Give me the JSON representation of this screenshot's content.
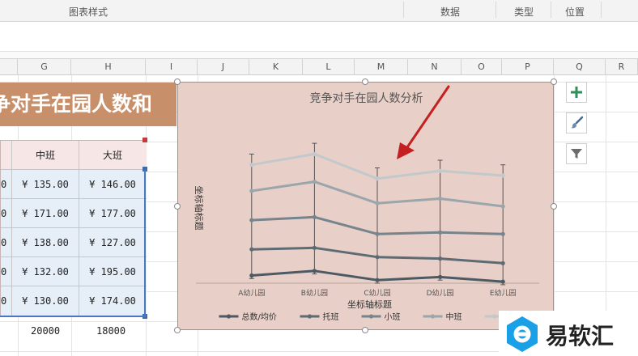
{
  "ribbon": {
    "groups": [
      {
        "label": "图表样式"
      },
      {
        "label": "数据"
      },
      {
        "label": "类型"
      },
      {
        "label": "位置"
      }
    ]
  },
  "columns": [
    "G",
    "H",
    "I",
    "J",
    "K",
    "L",
    "M",
    "N",
    "O",
    "P",
    "Q",
    "R"
  ],
  "sheet": {
    "banner_title": "争对手在园人数和",
    "table": {
      "headers": [
        "中班",
        "大班"
      ],
      "rows": [
        [
          "¥  135.00",
          "¥  146.00"
        ],
        [
          "¥  171.00",
          "¥  177.00"
        ],
        [
          "¥  138.00",
          "¥  127.00"
        ],
        [
          "¥  132.00",
          "¥  195.00"
        ],
        [
          "¥  130.00",
          "¥  174.00"
        ]
      ],
      "left_cut_cells": [
        "0",
        "0",
        "0",
        "0",
        "0"
      ],
      "total_row": [
        "20000",
        "18000"
      ]
    }
  },
  "chart_data": {
    "type": "line",
    "title": "竞争对手在园人数分析",
    "xlabel": "坐标轴标题",
    "ylabel": "坐标轴标题",
    "categories": [
      "A幼儿园",
      "B幼儿园",
      "C幼儿园",
      "D幼儿园",
      "E幼儿园"
    ],
    "stacked": true,
    "error_bars": true,
    "legend_position": "bottom",
    "series": [
      {
        "name": "总数/均价",
        "color": "#4d5a64",
        "values": [
          5,
          8,
          2,
          4,
          1
        ]
      },
      {
        "name": "托班",
        "color": "#5e6b74",
        "values": [
          22,
          23,
          17,
          16,
          13
        ]
      },
      {
        "name": "小班",
        "color": "#76848d",
        "values": [
          41,
          43,
          32,
          33,
          32
        ]
      },
      {
        "name": "中班",
        "color": "#9aa5ac",
        "values": [
          60,
          66,
          52,
          55,
          50
        ]
      },
      {
        "name": "大班",
        "color": "#c2c8cc",
        "values": [
          77,
          84,
          68,
          73,
          70
        ]
      }
    ]
  },
  "side_buttons": [
    {
      "icon": "plus-icon"
    },
    {
      "icon": "brush-icon"
    },
    {
      "icon": "filter-icon"
    }
  ],
  "watermark": {
    "text": "易软汇"
  }
}
